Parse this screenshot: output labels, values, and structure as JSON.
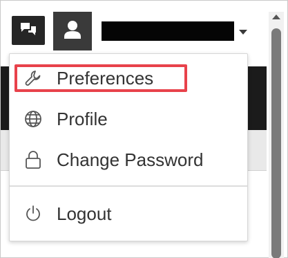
{
  "header": {
    "chat_icon": "chat-bubbles-icon",
    "user_icon": "user-icon",
    "username_redacted": true,
    "dropdown_icon": "caret-down-icon"
  },
  "menu": {
    "items": [
      {
        "label": "Preferences",
        "icon": "wrench-icon",
        "highlighted": true
      },
      {
        "label": "Profile",
        "icon": "globe-icon"
      },
      {
        "label": "Change Password",
        "icon": "lock-icon"
      },
      {
        "label": "Logout",
        "icon": "power-icon"
      }
    ]
  },
  "colors": {
    "highlight": "#e8424b",
    "toolbar_button": "#262626",
    "menu_text": "#333333"
  }
}
